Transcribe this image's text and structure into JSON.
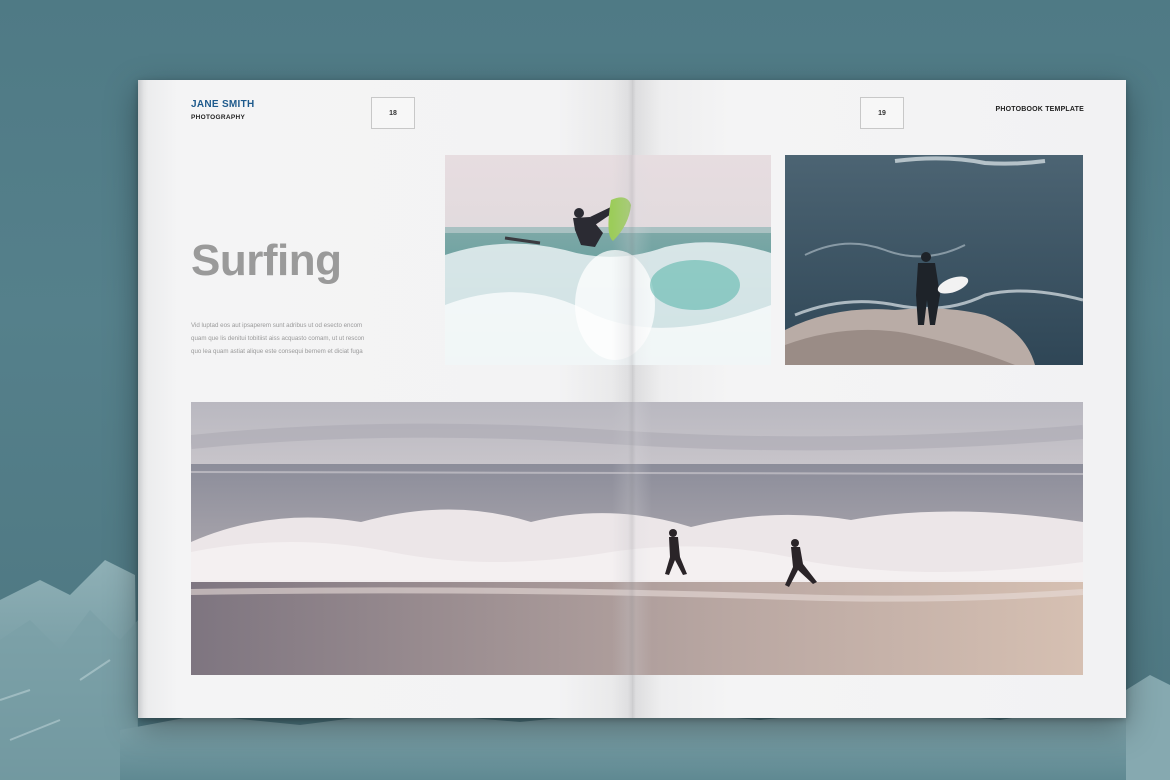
{
  "brand": {
    "name": "JANE SMITH",
    "sub": "PHOTOGRAPHY"
  },
  "pages": {
    "left_number": "18",
    "right_number": "19"
  },
  "template_label": "PHOTOBOOK TEMPLATE",
  "section": {
    "title": "Surfing",
    "body_lines": [
      "Vid luptad eos aut ipsaperem sunt adribus ut od esecto encom",
      "quam que lis denitui tobitiist aiss acquasto comam, ut ut rescon",
      "quo lea quam astiat alique este consequi bernem et diciat fuga"
    ]
  },
  "colors": {
    "brand_blue": "#1e5a8c",
    "title_gray": "#9a9a9a",
    "background": "#4f7a85"
  }
}
